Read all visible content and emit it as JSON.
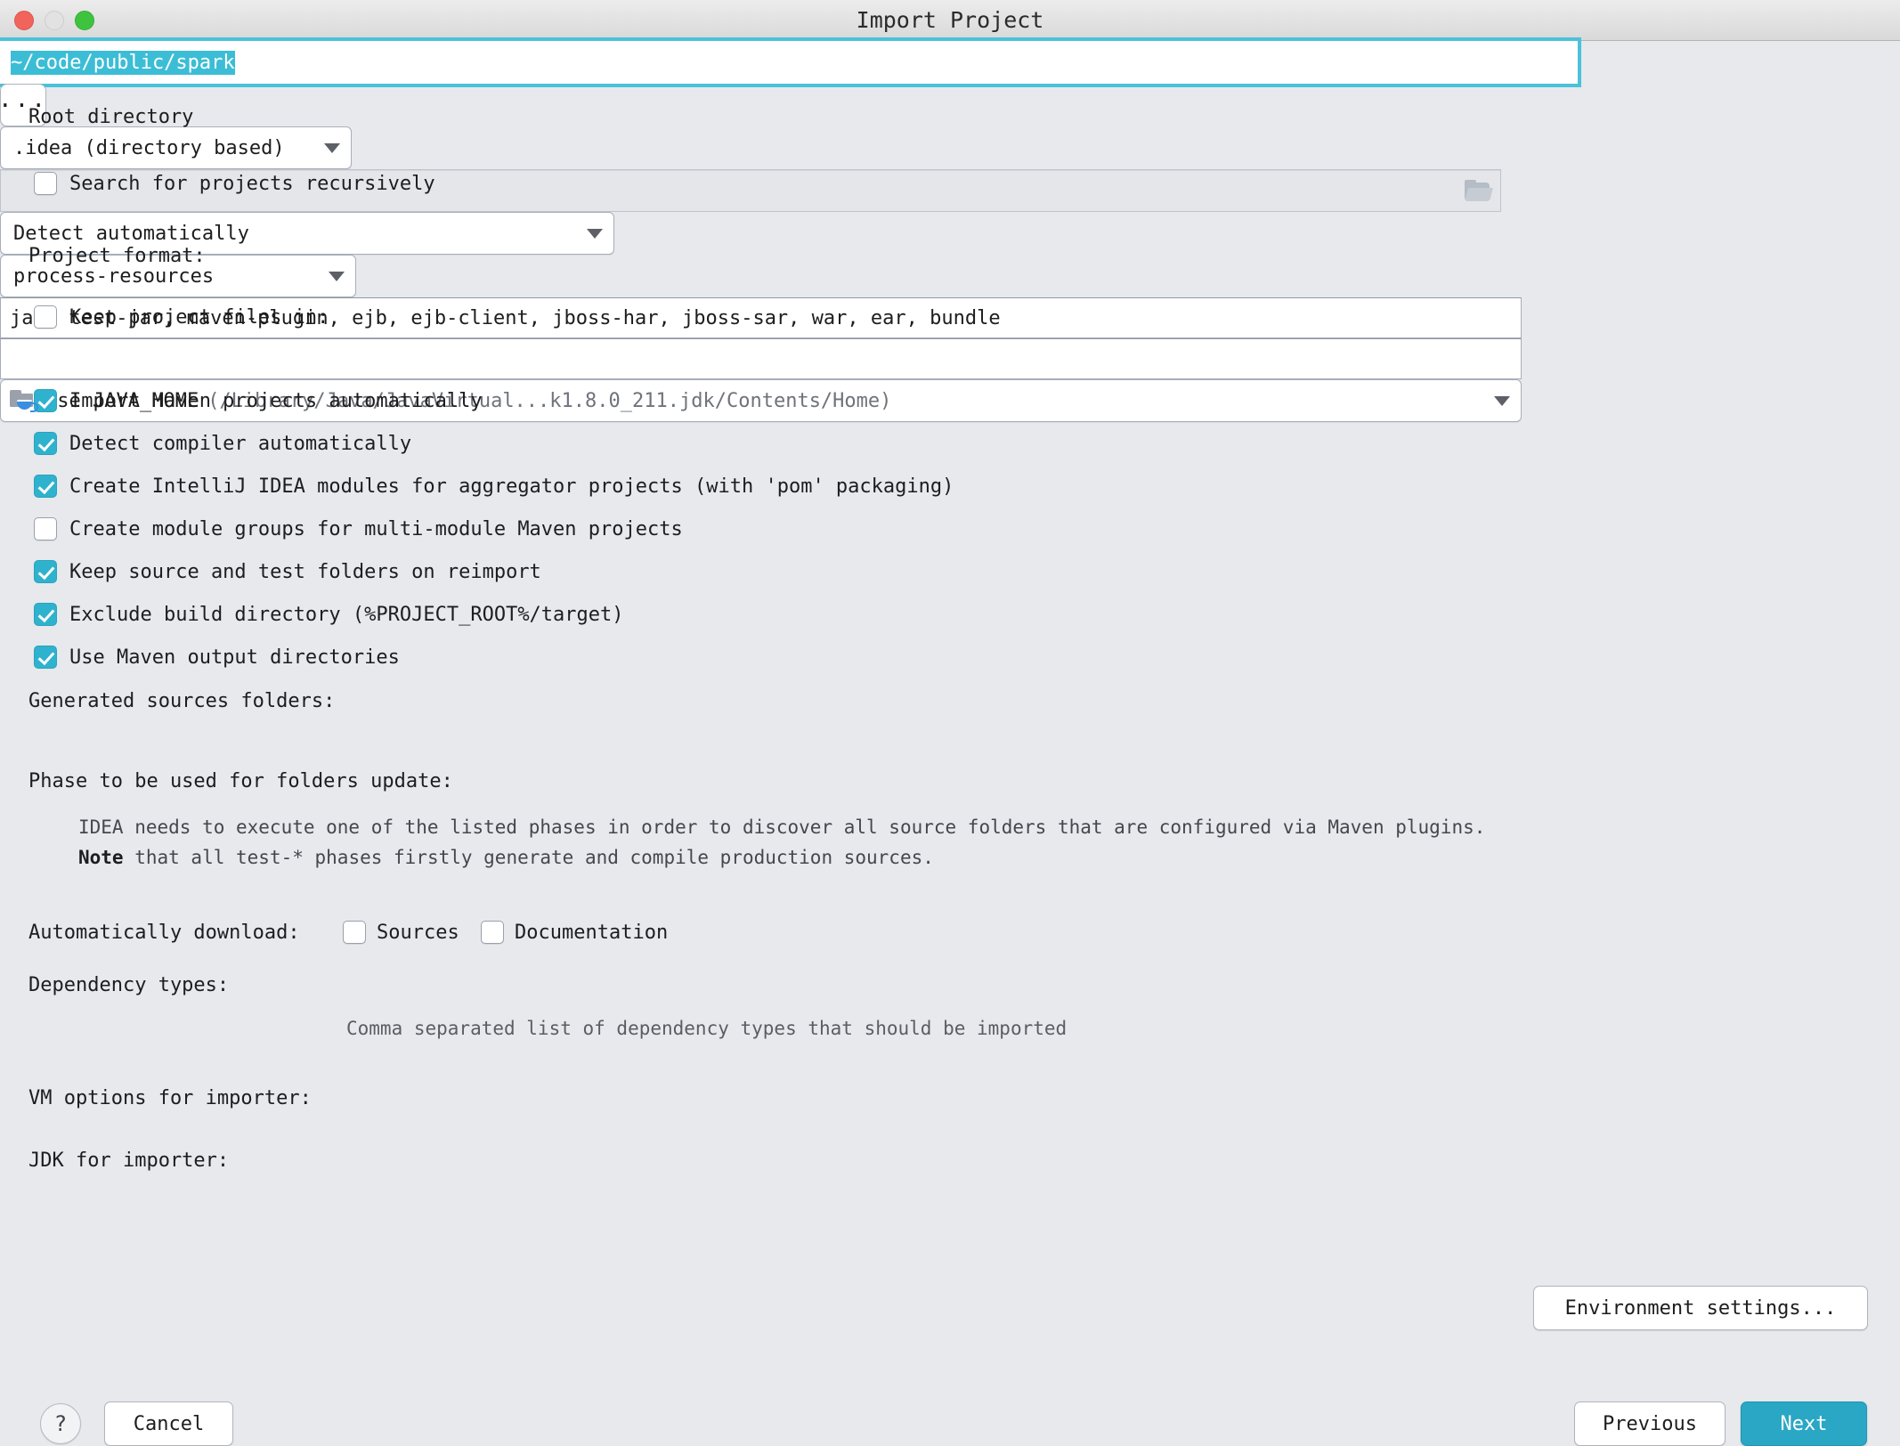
{
  "window": {
    "title": "Import Project",
    "traffic_lights": [
      "close",
      "minimize",
      "maximize"
    ]
  },
  "form": {
    "root_directory": {
      "label": "Root directory",
      "value": "~/code/public/spark",
      "selected": true,
      "browse_button": "..."
    },
    "search_recursively": {
      "label": "Search for projects recursively",
      "checked": false
    },
    "project_format": {
      "label": "Project format:",
      "value": ".idea (directory based)"
    },
    "keep_project_files": {
      "label": "Keep project files in:",
      "checked": false,
      "value": "",
      "disabled": true
    },
    "checkboxes": [
      {
        "label": "Import Maven projects automatically",
        "checked": true
      },
      {
        "label": "Detect compiler automatically",
        "checked": true
      },
      {
        "label": "Create IntelliJ IDEA modules for aggregator projects (with 'pom' packaging)",
        "checked": true
      },
      {
        "label": "Create module groups for multi-module Maven projects",
        "checked": false
      },
      {
        "label": "Keep source and test folders on reimport",
        "checked": true
      },
      {
        "label": "Exclude build directory (%PROJECT_ROOT%/target)",
        "checked": true
      },
      {
        "label": "Use Maven output directories",
        "checked": true
      }
    ],
    "generated_sources": {
      "label": "Generated sources folders:",
      "value": "Detect automatically"
    },
    "phase_update": {
      "label": "Phase to be used for folders update:",
      "value": "process-resources"
    },
    "note": {
      "line1": "IDEA needs to execute one of the listed phases in order to discover all source folders that are configured via Maven plugins.",
      "line2_bold": "Note",
      "line2_rest": " that all test-* phases firstly generate and compile production sources."
    },
    "auto_download": {
      "label": "Automatically download:",
      "sources": {
        "label": "Sources",
        "checked": false
      },
      "documentation": {
        "label": "Documentation",
        "checked": false
      }
    },
    "dependency_types": {
      "label": "Dependency types:",
      "value": "jar, test-jar, maven-plugin, ejb, ejb-client, jboss-har, jboss-sar, war, ear, bundle",
      "hint": "Comma separated list of dependency types that should be imported"
    },
    "vm_options": {
      "label": "VM options for importer:",
      "value": ""
    },
    "jdk_importer": {
      "label": "JDK for importer:",
      "value": "Use JAVA_HOME",
      "path": "(/Library/Java/JavaVirtual...k1.8.0_211.jdk/Contents/Home)"
    },
    "environment_settings_button": "Environment settings..."
  },
  "footer": {
    "help": "?",
    "cancel": "Cancel",
    "previous": "Previous",
    "next": "Next"
  },
  "colors": {
    "accent": "#2aa7c4",
    "checkbox_on": "#2fb2ce",
    "selection": "#3cbdd6",
    "dialog_bg": "#e7e9ed"
  }
}
